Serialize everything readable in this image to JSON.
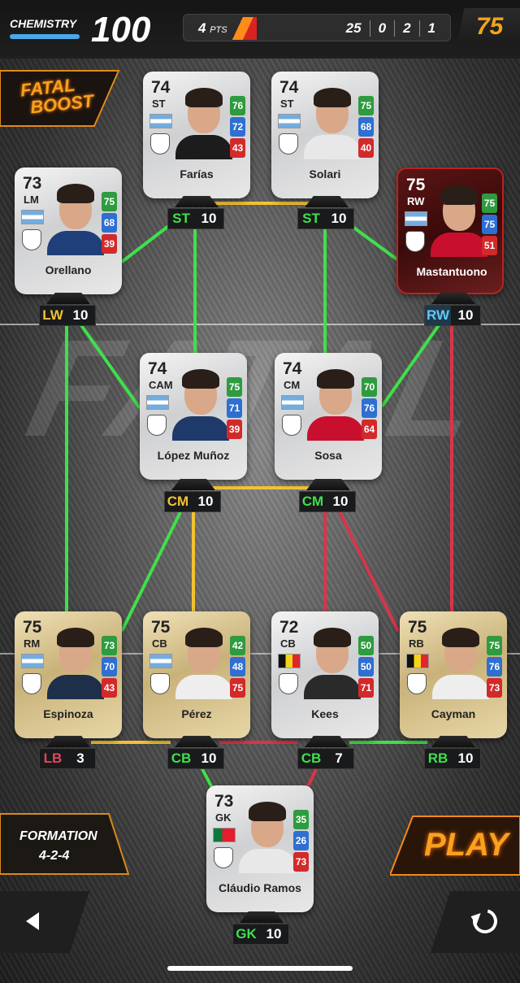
{
  "header": {
    "chemistry_label": "CHEMISTRY",
    "chemistry_value": "100",
    "points_value": "4",
    "points_unit": "PTS",
    "record": [
      "25",
      "0",
      "2",
      "1"
    ],
    "team_rating": "75"
  },
  "boost": {
    "line1": "FATAL",
    "line2": "BOOST"
  },
  "players": [
    {
      "rating": "74",
      "pos": "ST",
      "name": "Farías",
      "stats": [
        "76",
        "72",
        "43"
      ],
      "tag": {
        "code": "ST",
        "value": "10"
      }
    },
    {
      "rating": "74",
      "pos": "ST",
      "name": "Solari",
      "stats": [
        "75",
        "68",
        "40"
      ],
      "tag": {
        "code": "ST",
        "value": "10"
      }
    },
    {
      "rating": "73",
      "pos": "LM",
      "name": "Orellano",
      "stats": [
        "75",
        "68",
        "39"
      ],
      "tag": {
        "code": "LW",
        "value": "10"
      }
    },
    {
      "rating": "75",
      "pos": "RW",
      "name": "Mastantuono",
      "stats": [
        "75",
        "75",
        "51"
      ],
      "tag": {
        "code": "RW",
        "value": "10"
      }
    },
    {
      "rating": "74",
      "pos": "CAM",
      "name": "López Muñoz",
      "stats": [
        "75",
        "71",
        "39"
      ],
      "tag": {
        "code": "CM",
        "value": "10"
      }
    },
    {
      "rating": "74",
      "pos": "CM",
      "name": "Sosa",
      "stats": [
        "70",
        "76",
        "64"
      ],
      "tag": {
        "code": "CM",
        "value": "10"
      }
    },
    {
      "rating": "75",
      "pos": "RM",
      "name": "Espinoza",
      "stats": [
        "73",
        "70",
        "43"
      ],
      "tag": {
        "code": "LB",
        "value": "3"
      }
    },
    {
      "rating": "75",
      "pos": "CB",
      "name": "Pérez",
      "stats": [
        "42",
        "48",
        "75"
      ],
      "tag": {
        "code": "CB",
        "value": "10"
      }
    },
    {
      "rating": "72",
      "pos": "CB",
      "name": "Kees",
      "stats": [
        "50",
        "50",
        "71"
      ],
      "tag": {
        "code": "CB",
        "value": "7"
      }
    },
    {
      "rating": "75",
      "pos": "RB",
      "name": "Cayman",
      "stats": [
        "75",
        "76",
        "73"
      ],
      "tag": {
        "code": "RB",
        "value": "10"
      }
    },
    {
      "rating": "73",
      "pos": "GK",
      "name": "Cláudio Ramos",
      "stats": [
        "35",
        "26",
        "73"
      ],
      "tag": {
        "code": "GK",
        "value": "10"
      }
    }
  ],
  "formation": {
    "label": "FORMATION",
    "value": "4-2-4"
  },
  "play_label": "PLAY",
  "colors": {
    "link_green": "#3fe04a",
    "link_yellow": "#f3c233",
    "link_red": "#d8354a",
    "accent_orange": "#f6a21f"
  }
}
